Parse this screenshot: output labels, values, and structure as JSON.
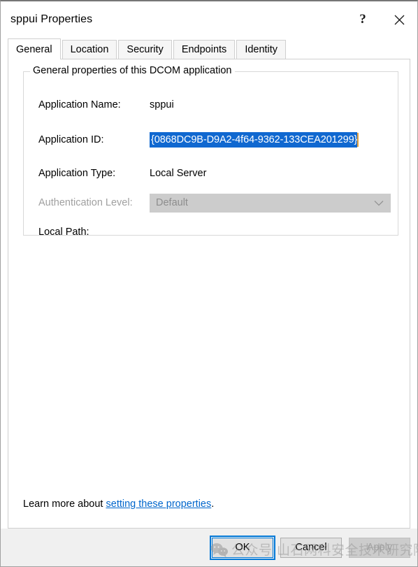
{
  "window": {
    "title": "sppui Properties",
    "help_button": "?",
    "close_button": "×"
  },
  "tabs": [
    {
      "label": "General",
      "selected": true
    },
    {
      "label": "Location",
      "selected": false
    },
    {
      "label": "Security",
      "selected": false
    },
    {
      "label": "Endpoints",
      "selected": false
    },
    {
      "label": "Identity",
      "selected": false
    }
  ],
  "groupbox": {
    "title": "General properties of this DCOM application",
    "fields": [
      {
        "label": "Application Name:",
        "value": "sppui",
        "type": "text",
        "disabled": false
      },
      {
        "label": "Application ID:",
        "value": "{0868DC9B-D9A2-4f64-9362-133CEA201299}",
        "type": "selected-edit",
        "disabled": false
      },
      {
        "label": "Application Type:",
        "value": "Local Server",
        "type": "text",
        "disabled": false
      },
      {
        "label": "Authentication Level:",
        "value": "Default",
        "type": "combobox",
        "disabled": true
      },
      {
        "label": "Local Path:",
        "value": "",
        "type": "text",
        "disabled": false
      }
    ]
  },
  "learn_more": {
    "prefix": "Learn more about ",
    "link_text": "setting these properties",
    "suffix": "."
  },
  "footer": {
    "ok_label": "OK",
    "cancel_label": "Cancel",
    "apply_label": "Apply"
  },
  "watermark": {
    "icon": "wechat-icon",
    "text": "公众号 山石网科安全技术研究院"
  },
  "colors": {
    "selection_blue": "#1068d0",
    "accent_blue": "#0078d7",
    "link_blue": "#0066cc",
    "caret_orange": "#e8a33d",
    "footer_grey": "#f0f0f0",
    "disabled_grey": "#cccccc"
  }
}
